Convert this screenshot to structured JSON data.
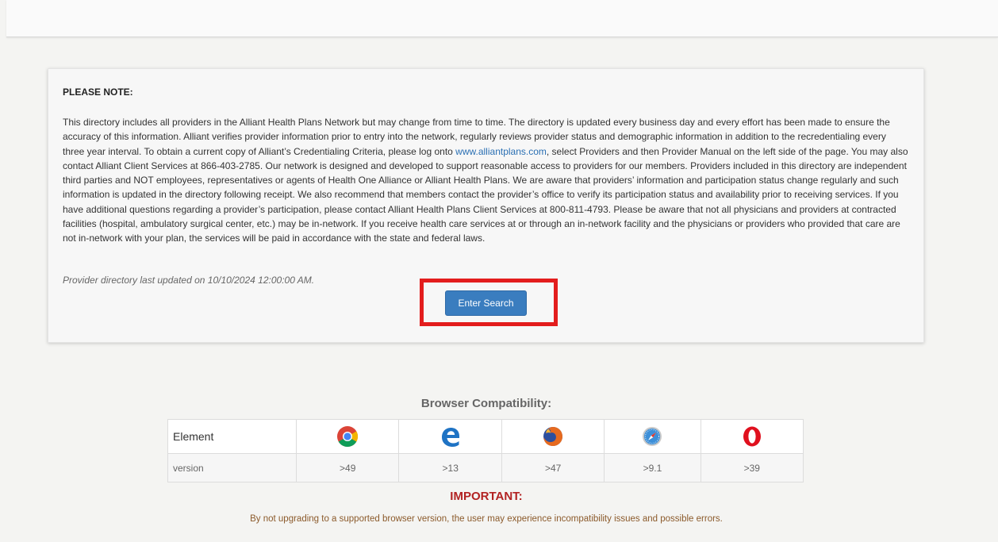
{
  "notice": {
    "title": "PLEASE NOTE:",
    "body_1": "This directory includes all providers in the Alliant Health Plans Network but may change from time to time. The directory is updated every business day and every effort has been made to ensure the accuracy of this information. Alliant verifies provider information prior to entry into the network, regularly reviews provider status and demographic information in addition to the recredentialing every three year interval. To obtain a current copy of Alliant’s Credentialing Criteria, please log onto ",
    "link_text": "www.alliantplans.com",
    "body_2": ", select Providers and then Provider Manual on the left side of the page. You may also contact Alliant Client Services at 866-403-2785. Our network is designed and developed to support reasonable access to providers for our members. Providers included in this directory are independent third parties and NOT employees, representatives or agents of Health One Alliance or Alliant Health Plans. We are aware that providers’ information and participation status change regularly and such information is updated in the directory following receipt. We also recommend that members contact the provider’s office to verify its participation status and availability prior to receiving services. If you have additional questions regarding a provider’s participation, please contact Alliant Health Plans Client Services at 800-811-4793. Please be aware that not all physicians and providers at contracted facilities (hospital, ambulatory surgical center, etc.) may be in-network. If you receive health care services at or through an in-network facility and the physicians or providers who provided that care are not in-network with your plan, the services will be paid in accordance with the state and federal laws.",
    "last_updated": "Provider directory last updated on 10/10/2024 12:00:00 AM.",
    "button_label": "Enter Search"
  },
  "compat": {
    "title": "Browser Compatibility:",
    "row1_label": "Element",
    "row2_label": "version",
    "browsers": [
      {
        "icon": "chrome-icon",
        "version": ">49"
      },
      {
        "icon": "edge-icon",
        "version": ">13"
      },
      {
        "icon": "firefox-icon",
        "version": ">47"
      },
      {
        "icon": "safari-icon",
        "version": ">9.1"
      },
      {
        "icon": "opera-icon",
        "version": ">39"
      }
    ],
    "important_title": "IMPORTANT:",
    "warning_text": "By not upgrading to a supported browser version, the user may experience incompatibility issues and possible errors."
  },
  "colors": {
    "highlight": "#e31d1d",
    "button": "#3a7dbf",
    "important": "#b22222",
    "warning": "#8b5a2b",
    "link": "#2a6fb3"
  }
}
